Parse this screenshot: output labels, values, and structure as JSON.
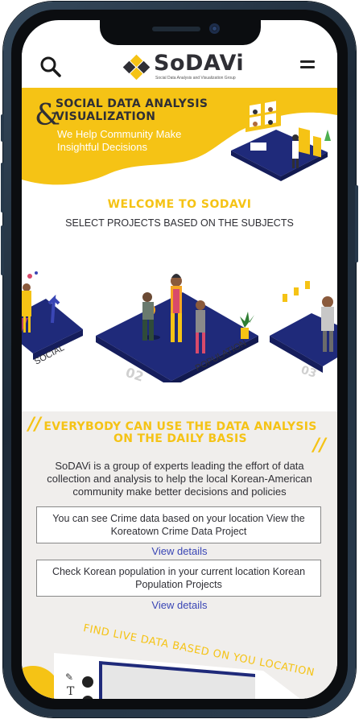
{
  "header": {
    "logo_title": "SoDAVi",
    "logo_subtitle": "Social Data Analysis and Visualization Group",
    "search_icon": "search-icon",
    "menu_icon": "hamburger-menu-icon"
  },
  "hero": {
    "title_line1": "SOCIAL DATA ANALYSIS",
    "title_line2": "VISUALIZATION",
    "ampersand": "&",
    "subtitle": "We Help Community Make Insightful Decisions"
  },
  "welcome": {
    "title": "WELCOME TO SODAVI",
    "subtitle": "SELECT PROJECTS BASED ON THE SUBJECTS"
  },
  "projects": [
    {
      "label": "SOCIAL",
      "number": ""
    },
    {
      "label": "POPULATION",
      "number": "02"
    },
    {
      "label": "",
      "number": "03"
    }
  ],
  "info": {
    "title": "EVERYBODY CAN USE THE DATA ANALYSIS ON THE DAILY BASIS",
    "description": "SoDAVi is a group of experts leading the effort of data collection and analysis to help the local Korean-American community make better decisions and policies",
    "cards": [
      {
        "text": "You can see Crime data based on your location View the Koreatown Crime Data Project",
        "link": "View details"
      },
      {
        "text": "Check Korean population in your current location Korean Population Projects",
        "link": "View details"
      }
    ],
    "find_text": "FIND LIVE DATA BASED ON YOU LOCATION"
  },
  "colors": {
    "accent": "#f5c315",
    "navy": "#1f2a7a",
    "text": "#2f2f35",
    "link": "#3a46b5"
  }
}
